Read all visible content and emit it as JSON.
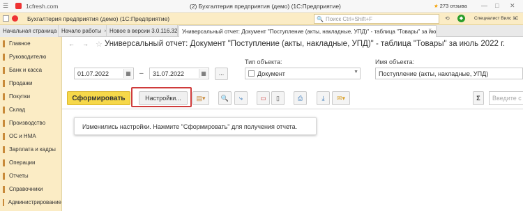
{
  "browser": {
    "url": "1cfresh.com",
    "title": "(2) Бухгалтерия предприятия (демо) (1С:Предприятие)",
    "reviews": "273 отзыва"
  },
  "app": {
    "title": "Бухгалтерия предприятия (демо)  (1С:Предприятие)",
    "search_placeholder": "Поиск Ctrl+Shift+F",
    "user": "Специалист Вилс 1С"
  },
  "tabs": [
    {
      "label": "Начальная страница"
    },
    {
      "label": "Начало работы"
    },
    {
      "label": "Новое в версии 3.0.116.32"
    },
    {
      "label": "Универсальный отчет: Документ \"Поступление (акты, накладные, УПД)\" - таблица \"Товары\" за июль 2022 г."
    }
  ],
  "sidebar": {
    "items": [
      {
        "label": "Главное"
      },
      {
        "label": "Руководителю"
      },
      {
        "label": "Банк и касса"
      },
      {
        "label": "Продажи"
      },
      {
        "label": "Покупки"
      },
      {
        "label": "Склад"
      },
      {
        "label": "Производство"
      },
      {
        "label": "ОС и НМА"
      },
      {
        "label": "Зарплата и кадры"
      },
      {
        "label": "Операции"
      },
      {
        "label": "Отчеты"
      },
      {
        "label": "Справочники"
      },
      {
        "label": "Администрирование"
      }
    ]
  },
  "report": {
    "title": "Универсальный отчет: Документ \"Поступление (акты, накладные, УПД)\" - таблица \"Товары\" за июль 2022 г.",
    "date_from": "01.07.2022",
    "date_sep": "–",
    "date_to": "31.07.2022",
    "ellipsis": "...",
    "object_type_label": "Тип объекта:",
    "object_type_value": "Документ",
    "object_name_label": "Имя объекта:",
    "object_name_value": "Поступление (акты, накладные, УПД)",
    "generate_label": "Сформировать",
    "settings_label": "Настройки...",
    "search_placeholder": "Введите с",
    "message": "Изменились настройки. Нажмите \"Сформировать\" для получения отчета."
  },
  "colors": {
    "accent": "#f6d84a",
    "panel": "#fbecc5",
    "highlight_frame": "#cf3b3b"
  }
}
